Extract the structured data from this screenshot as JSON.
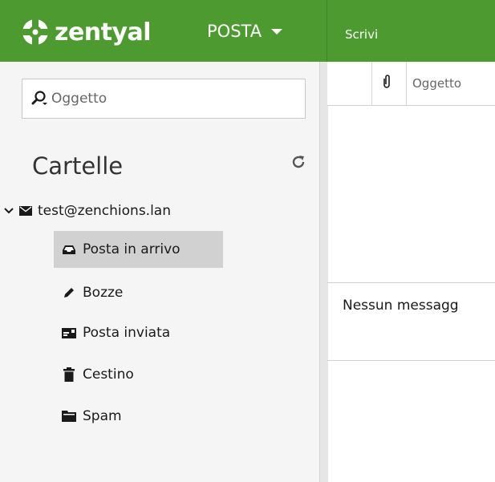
{
  "header": {
    "brand": "zentyal",
    "module": "POSTA",
    "compose_label": "Scrivi",
    "brand_color": "#4d9b30"
  },
  "sidebar": {
    "search_placeholder": "Oggetto",
    "folders_title": "Cartelle",
    "refresh_icon": "refresh-icon",
    "account": "test@zenchions.lan",
    "folders": [
      {
        "label": "Posta in arrivo",
        "icon": "inbox-icon",
        "active": true
      },
      {
        "label": "Bozze",
        "icon": "pencil-icon",
        "active": false
      },
      {
        "label": "Posta inviata",
        "icon": "sent-icon",
        "active": false
      },
      {
        "label": "Cestino",
        "icon": "trash-icon",
        "active": false
      },
      {
        "label": "Spam",
        "icon": "folder-icon",
        "active": false
      }
    ]
  },
  "list": {
    "columns": {
      "attachment_icon": "paperclip-icon",
      "subject": "Oggetto"
    },
    "empty_message": "Nessun messagg"
  }
}
